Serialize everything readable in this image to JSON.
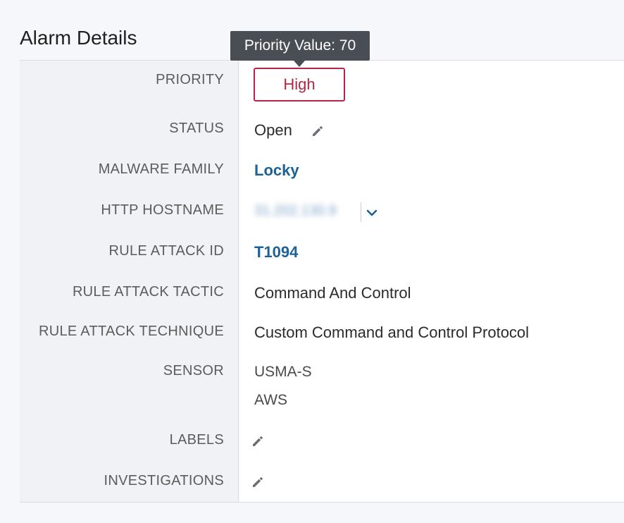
{
  "panel": {
    "title": "Alarm Details"
  },
  "tooltip": {
    "text": "Priority Value: 70"
  },
  "rows": {
    "priority": {
      "label": "PRIORITY",
      "value": "High"
    },
    "status": {
      "label": "STATUS",
      "value": "Open"
    },
    "malware_family": {
      "label": "MALWARE FAMILY",
      "value": "Locky"
    },
    "http_hostname": {
      "label": "HTTP HOSTNAME",
      "value": "31.202.130.9"
    },
    "rule_attack_id": {
      "label": "RULE ATTACK ID",
      "value": "T1094"
    },
    "rule_attack_tactic": {
      "label": "RULE ATTACK TACTIC",
      "value": "Command And Control"
    },
    "rule_attack_technique": {
      "label": "RULE ATTACK TECHNIQUE",
      "value": "Custom Command and Control Protocol"
    },
    "sensor": {
      "label": "SENSOR",
      "values": [
        "USMA-S",
        "AWS"
      ]
    },
    "labels": {
      "label": "LABELS"
    },
    "investigations": {
      "label": "INVESTIGATIONS"
    }
  },
  "colors": {
    "priority_high": "#b3264a",
    "link": "#1d6296",
    "tooltip_bg": "#494d54"
  },
  "icons": {
    "edit": "pencil-icon",
    "expand": "chevron-down-icon"
  }
}
